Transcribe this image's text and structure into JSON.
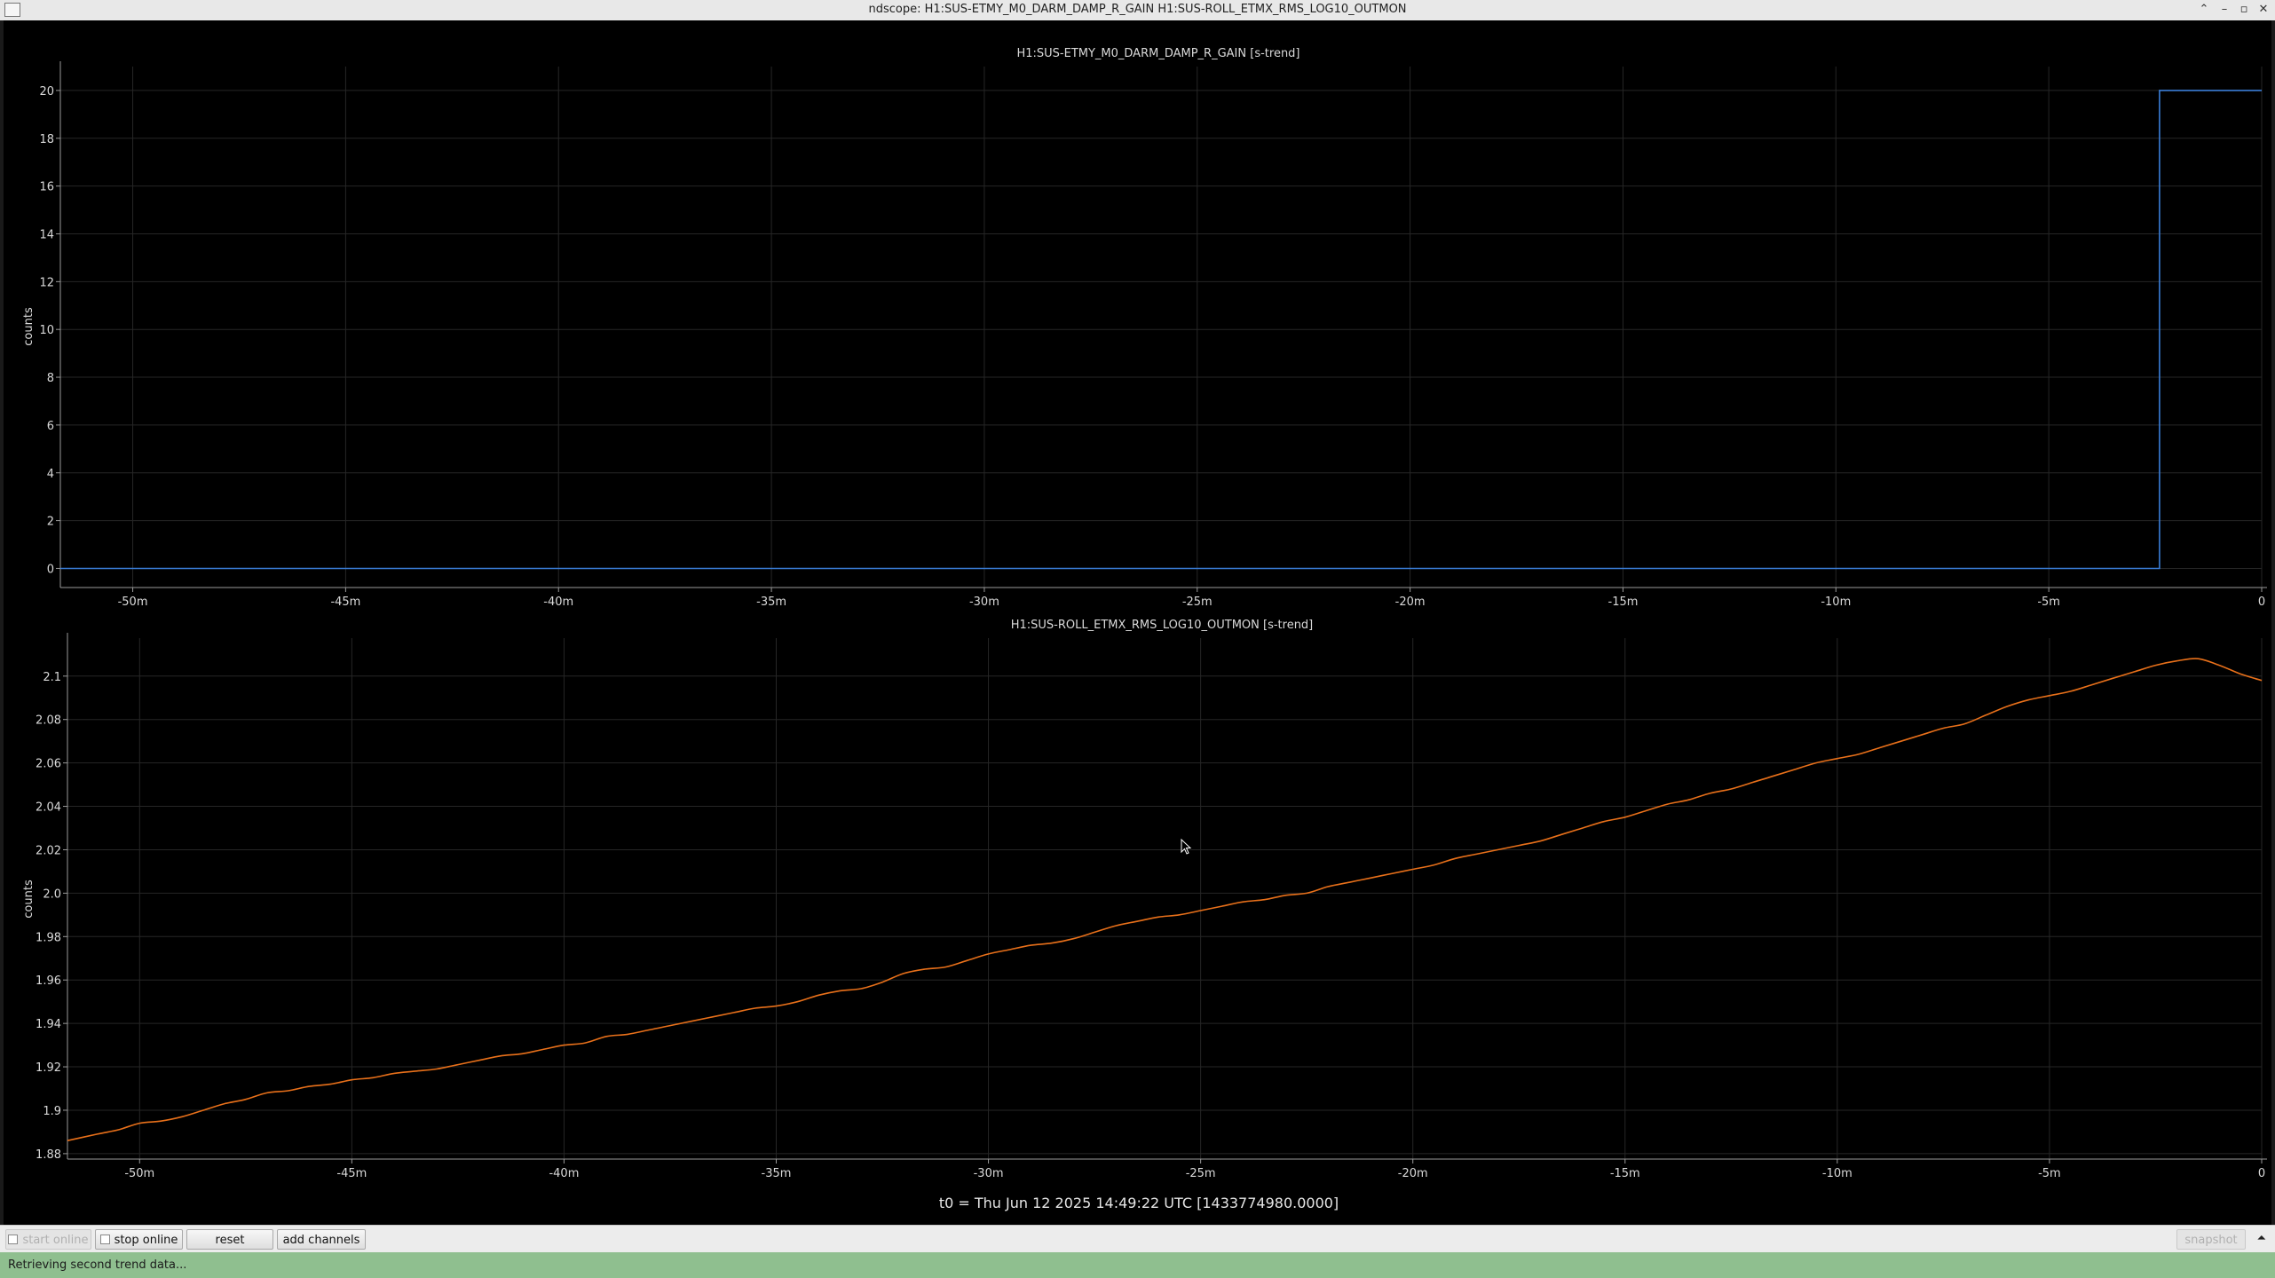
{
  "window": {
    "title": "ndscope: H1:SUS-ETMY_M0_DARM_DAMP_R_GAIN H1:SUS-ROLL_ETMX_RMS_LOG10_OUTMON",
    "buttons": {
      "collapse": "⌃",
      "minimize": "–",
      "maximize": "▫",
      "close": "✕"
    }
  },
  "chart_data": [
    {
      "type": "line",
      "title": "H1:SUS-ETMY_M0_DARM_DAMP_R_GAIN [s-trend]",
      "ylabel": "counts",
      "xlim": [
        -51.7,
        0
      ],
      "ylim": [
        -0.8,
        21
      ],
      "x_ticks": [
        -50,
        -45,
        -40,
        -35,
        -30,
        -25,
        -20,
        -15,
        -10,
        -5,
        0
      ],
      "x_tick_labels": [
        "-50m",
        "-45m",
        "-40m",
        "-35m",
        "-30m",
        "-25m",
        "-20m",
        "-15m",
        "-10m",
        "-5m",
        "0"
      ],
      "y_ticks": [
        0,
        2,
        4,
        6,
        8,
        10,
        12,
        14,
        16,
        18,
        20
      ],
      "y_tick_labels": [
        "0",
        "2",
        "4",
        "6",
        "8",
        "10",
        "12",
        "14",
        "16",
        "18",
        "20"
      ],
      "grid": true,
      "color": "#3a7dd6",
      "series": [
        {
          "name": "H1:SUS-ETMY_M0_DARM_DAMP_R_GAIN",
          "x": [
            -51.7,
            -2.4,
            -2.4,
            0
          ],
          "values": [
            0,
            0,
            20,
            20
          ]
        }
      ]
    },
    {
      "type": "line",
      "title": "H1:SUS-ROLL_ETMX_RMS_LOG10_OUTMON [s-trend]",
      "ylabel": "counts",
      "xlim": [
        -51.7,
        0
      ],
      "ylim": [
        1.8775,
        2.1175
      ],
      "x_ticks": [
        -50,
        -45,
        -40,
        -35,
        -30,
        -25,
        -20,
        -15,
        -10,
        -5,
        0
      ],
      "x_tick_labels": [
        "-50m",
        "-45m",
        "-40m",
        "-35m",
        "-30m",
        "-25m",
        "-20m",
        "-15m",
        "-10m",
        "-5m",
        "0"
      ],
      "y_ticks": [
        1.88,
        1.9,
        1.92,
        1.94,
        1.96,
        1.98,
        2.0,
        2.02,
        2.04,
        2.06,
        2.08,
        2.1
      ],
      "y_tick_labels": [
        "1.88",
        "1.9",
        "1.92",
        "1.94",
        "1.96",
        "1.98",
        "2.0",
        "2.02",
        "2.04",
        "2.06",
        "2.08",
        "2.1"
      ],
      "grid": true,
      "color": "#e8701a",
      "series": [
        {
          "name": "H1:SUS-ROLL_ETMX_RMS_LOG10_OUTMON",
          "x": [
            -51.7,
            -51.0,
            -50.5,
            -50.0,
            -49.5,
            -49.0,
            -48.5,
            -48.0,
            -47.5,
            -47.0,
            -46.5,
            -46.0,
            -45.5,
            -45.0,
            -44.5,
            -44.0,
            -43.5,
            -43.0,
            -42.5,
            -42.0,
            -41.5,
            -41.0,
            -40.5,
            -40.0,
            -39.5,
            -39.0,
            -38.5,
            -38.0,
            -37.5,
            -37.0,
            -36.5,
            -36.0,
            -35.5,
            -35.0,
            -34.5,
            -34.0,
            -33.5,
            -33.0,
            -32.5,
            -32.0,
            -31.5,
            -31.0,
            -30.5,
            -30.0,
            -29.5,
            -29.0,
            -28.5,
            -28.0,
            -27.5,
            -27.0,
            -26.5,
            -26.0,
            -25.5,
            -25.0,
            -24.5,
            -24.0,
            -23.5,
            -23.0,
            -22.5,
            -22.0,
            -21.5,
            -21.0,
            -20.5,
            -20.0,
            -19.5,
            -19.0,
            -18.5,
            -18.0,
            -17.5,
            -17.0,
            -16.5,
            -16.0,
            -15.5,
            -15.0,
            -14.5,
            -14.0,
            -13.5,
            -13.0,
            -12.5,
            -12.0,
            -11.5,
            -11.0,
            -10.5,
            -10.0,
            -9.5,
            -9.0,
            -8.5,
            -8.0,
            -7.5,
            -7.0,
            -6.5,
            -6.0,
            -5.5,
            -5.0,
            -4.5,
            -4.0,
            -3.5,
            -3.0,
            -2.5,
            -2.0,
            -1.5,
            -1.0,
            -0.5,
            0.0
          ],
          "values": [
            1.886,
            1.889,
            1.891,
            1.894,
            1.895,
            1.897,
            1.9,
            1.903,
            1.905,
            1.908,
            1.909,
            1.911,
            1.912,
            1.914,
            1.915,
            1.917,
            1.918,
            1.919,
            1.921,
            1.923,
            1.925,
            1.926,
            1.928,
            1.93,
            1.931,
            1.934,
            1.935,
            1.937,
            1.939,
            1.941,
            1.943,
            1.945,
            1.947,
            1.948,
            1.95,
            1.953,
            1.955,
            1.956,
            1.959,
            1.963,
            1.965,
            1.966,
            1.969,
            1.972,
            1.974,
            1.976,
            1.977,
            1.979,
            1.982,
            1.985,
            1.987,
            1.989,
            1.99,
            1.992,
            1.994,
            1.996,
            1.997,
            1.999,
            2.0,
            2.003,
            2.005,
            2.007,
            2.009,
            2.011,
            2.013,
            2.016,
            2.018,
            2.02,
            2.022,
            2.024,
            2.027,
            2.03,
            2.033,
            2.035,
            2.038,
            2.041,
            2.043,
            2.046,
            2.048,
            2.051,
            2.054,
            2.057,
            2.06,
            2.062,
            2.064,
            2.067,
            2.07,
            2.073,
            2.076,
            2.078,
            2.082,
            2.086,
            2.089,
            2.091,
            2.093,
            2.096,
            2.099,
            2.102,
            2.105,
            2.107,
            2.108,
            2.105,
            2.101,
            2.098
          ]
        }
      ]
    }
  ],
  "time_label": "t0 = Thu Jun 12 2025 14:49:22 UTC [1433774980.0000]",
  "toolbar": {
    "start_online": "start online",
    "stop_online": "stop online",
    "reset": "reset",
    "add_channels": "add channels",
    "snapshot": "snapshot",
    "collapse": "⏶"
  },
  "status": {
    "message": "Retrieving second trend data..."
  },
  "cursor": "mouse-pointer-icon"
}
